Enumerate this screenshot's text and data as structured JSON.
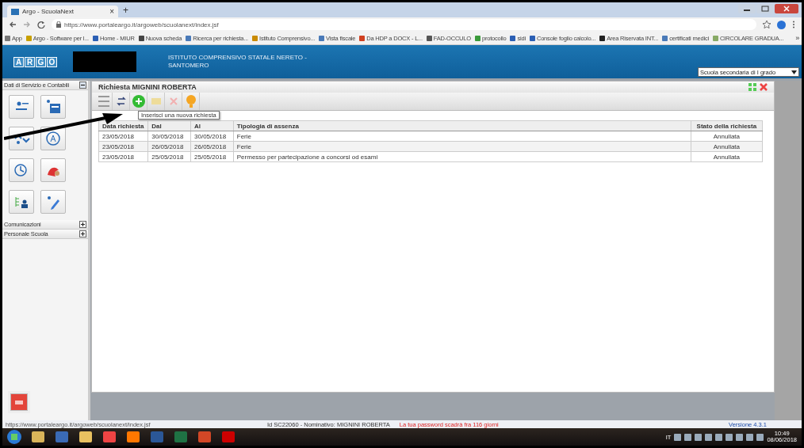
{
  "browser": {
    "tab_title": "Argo - ScuolaNext",
    "tab_close": "×",
    "new_tab": "+",
    "url": "https://www.portaleargo.it/argoweb/scuolanext/index.jsf",
    "bookmarks": [
      "App",
      "Argo - Software per l...",
      "Home - MIUR",
      "Nuova scheda",
      "Ricerca per richiesta...",
      "Istituto Comprensivo...",
      "Vista fiscale",
      "Da HDP a DOCX - L...",
      "FAD-OCCULO",
      "protocollo",
      "sidi",
      "Console foglio calcolo...",
      "Area Riservata INT...",
      "certificati medici",
      "CIRCOLARE GRADUA..."
    ],
    "bookmarks_more": "»"
  },
  "app_header": {
    "logo_letters": [
      "A",
      "R",
      "G",
      "O"
    ],
    "school": "ISTITUTO COMPRENSIVO STATALE NERETO - SANTOMERO",
    "school_type": "Scuola secondaria di I grado"
  },
  "sidebar": {
    "sections": [
      {
        "title": "Dati di Servizio e Contabili",
        "expanded": true
      },
      {
        "title": "Comunicazioni",
        "expanded": false
      },
      {
        "title": "Personale Scuola",
        "expanded": false
      }
    ]
  },
  "panel": {
    "title": "Richiesta MIGNINI ROBERTA",
    "tooltip": "Inserisci una nuova richiesta",
    "columns": [
      "Data richiesta",
      "Dal",
      "Al",
      "Tipologia di assenza",
      "Stato della richiesta"
    ],
    "rows": [
      {
        "cells": [
          "23/05/2018",
          "30/05/2018",
          "30/05/2018",
          "Ferie",
          "Annullata"
        ]
      },
      {
        "cells": [
          "23/05/2018",
          "26/05/2018",
          "26/05/2018",
          "Ferie",
          "Annullata"
        ]
      },
      {
        "cells": [
          "23/05/2018",
          "25/05/2018",
          "25/05/2018",
          "Permesso per partecipazione a concorsi od esami",
          "Annullata"
        ]
      }
    ]
  },
  "status_bar": {
    "url": "https://www.portaleargo.it/argoweb/scuolanext/index.jsf",
    "user": "Id SC22060 - Nominativo: MIGNINI ROBERTA",
    "password_notice": "La tua password scadrà fra 116 giorni",
    "version": "Versione 4.3.1"
  },
  "taskbar": {
    "language": "IT",
    "time": "10:49",
    "date": "08/06/2018"
  }
}
